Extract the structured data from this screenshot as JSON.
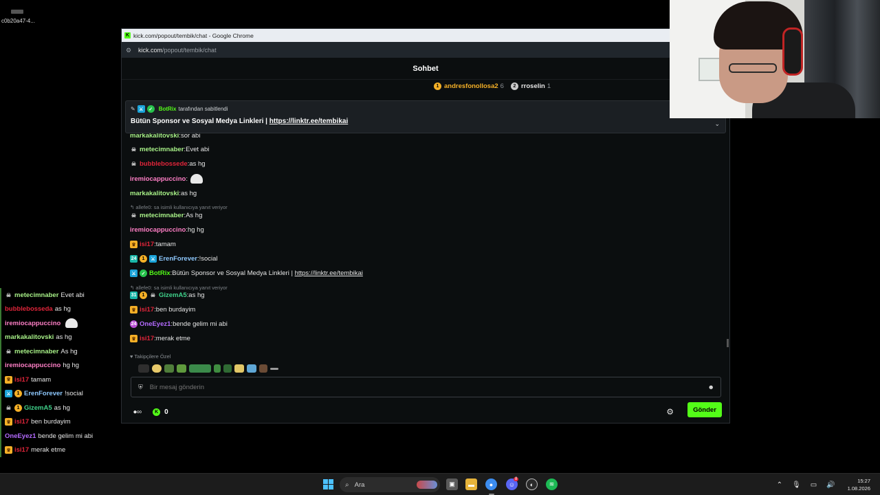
{
  "desktop": {
    "file_label": "c0b20a47-4..."
  },
  "window": {
    "title": "kick.com/popout/tembik/chat - Google Chrome",
    "url_host": "kick.com",
    "url_path": "/popout/tembik/chat"
  },
  "chat": {
    "header": "Sohbet",
    "leaderboard": [
      {
        "rank": "1",
        "name": "andresfonollosa2",
        "count": "6"
      },
      {
        "rank": "2",
        "name": "rroselin",
        "count": "1"
      }
    ],
    "pinned": {
      "bot_name": "BotRix",
      "pinned_by_text": "tarafından sabitlendi",
      "message_text": "Bütün Sponsor ve Sosyal Medya Linkleri |",
      "message_link": "https://linktr.ee/tembikai"
    },
    "messages": [
      {
        "user": "markakalitovski",
        "text": "sor abi",
        "color": "#a7f087"
      },
      {
        "user": "metecimnaber",
        "text": "Evet abi",
        "color": "#a7f087"
      },
      {
        "user": "bubblebossede",
        "text": "as hg",
        "color": "#e0253a"
      },
      {
        "user": "iremiocappuccino",
        "text": "",
        "color": "#ff7fc6"
      },
      {
        "user": "markakalitovski",
        "text": "as hg",
        "color": "#a7f087"
      },
      {
        "user": "metecimnaber",
        "text": "As hg",
        "color": "#a7f087"
      },
      {
        "user": "iremiocappuccino",
        "text": "hg hg",
        "color": "#ff7fc6"
      },
      {
        "user": "isi17",
        "text": "tamam",
        "color": "#e0253a"
      },
      {
        "user": "ErenForever",
        "text": "!social",
        "color": "#8fc9ff"
      },
      {
        "user": "BotRix",
        "text": "Bütün Sponsor ve Sosyal Medya Linkleri |",
        "link": "https://linktr.ee/tembikai",
        "color": "#53fc18"
      },
      {
        "user": "GizemA5",
        "text": "as hg",
        "color": "#3fd18a"
      },
      {
        "user": "isi17",
        "text": "ben burdayim",
        "color": "#e0253a"
      },
      {
        "user": "OneEyez1",
        "text": "bende gelim mi abi",
        "color": "#b46bff"
      },
      {
        "user": "isi17",
        "text": "merak etme",
        "color": "#e0253a"
      }
    ],
    "replies": [
      {
        "text": "allefe0: sa isimli kullanıcıya yanıt veriyor"
      },
      {
        "text": "allefe0: sa isimli kullanıcıya yanıt veriyor"
      }
    ],
    "badges": {
      "sub": "24",
      "sub2": "31",
      "og": "24"
    },
    "follow_only_label": "Takipçilere Özel",
    "input_placeholder": "Bir mesaj gönderin",
    "points": "0",
    "send_label": "Gönder"
  },
  "overlay": [
    {
      "user": "metecimnaber",
      "text": "Evet abi",
      "color": "#a7f087"
    },
    {
      "user": "bubblebosseda",
      "text": "as hg",
      "color": "#e0253a"
    },
    {
      "user": "iremiocappuccino",
      "text": "",
      "color": "#ff7fc6"
    },
    {
      "user": "markakalitovski",
      "text": "as hg",
      "color": "#a7f087"
    },
    {
      "user": "metecimnaber",
      "text": "As hg",
      "color": "#a7f087"
    },
    {
      "user": "iremiocappuccino",
      "text": "hg hg",
      "color": "#ff7fc6"
    },
    {
      "user": "isi17",
      "text": "tamam",
      "color": "#e0253a"
    },
    {
      "user": "ErenForever",
      "text": "!social",
      "color": "#8fc9ff"
    },
    {
      "user": "GizemA5",
      "text": "as hg",
      "color": "#3fd18a"
    },
    {
      "user": "isi17",
      "text": "ben burdayim",
      "color": "#e0253a"
    },
    {
      "user": "OneEyez1",
      "text": "bende gelim mi abi",
      "color": "#b46bff"
    },
    {
      "user": "isi17",
      "text": "merak etme",
      "color": "#e0253a"
    }
  ],
  "taskbar": {
    "search_label": "Ara",
    "discord_badge": "8",
    "time": "15:27",
    "date": "1.08.2026"
  },
  "colors": {
    "kick_green": "#53fc18",
    "gold": "#f5b027"
  }
}
